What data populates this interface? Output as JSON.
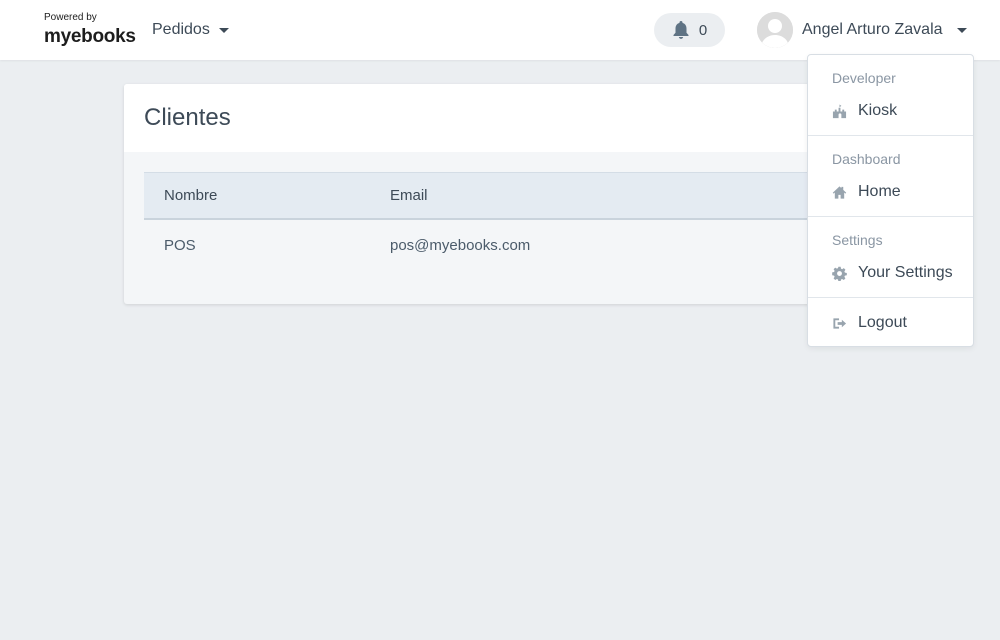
{
  "brand": {
    "powered_by": "Powered by",
    "name_prefix": "my",
    "name_accent": "e",
    "name_suffix": "books"
  },
  "nav": {
    "pedidos_label": "Pedidos"
  },
  "notifications": {
    "count": "0",
    "icon": "bell-icon"
  },
  "user": {
    "name": "Angel Arturo Zavala",
    "avatar_icon": "user-avatar-icon"
  },
  "card": {
    "title": "Clientes",
    "columns": [
      "Nombre",
      "Email"
    ],
    "rows": [
      {
        "nombre": "POS",
        "email": "pos@myebooks.com"
      }
    ]
  },
  "dropdown": {
    "sections": [
      {
        "header": "Developer",
        "items": [
          {
            "label": "Kiosk",
            "icon": "castle-icon"
          }
        ]
      },
      {
        "header": "Dashboard",
        "items": [
          {
            "label": "Home",
            "icon": "home-icon"
          }
        ]
      },
      {
        "header": "Settings",
        "items": [
          {
            "label": "Your Settings",
            "icon": "gear-icon"
          }
        ]
      },
      {
        "header": "",
        "items": [
          {
            "label": "Logout",
            "icon": "logout-icon"
          }
        ]
      }
    ]
  },
  "colors": {
    "icon_gray": "#98a4ae",
    "background": "#ebeef1",
    "text": "#3d4a57"
  }
}
